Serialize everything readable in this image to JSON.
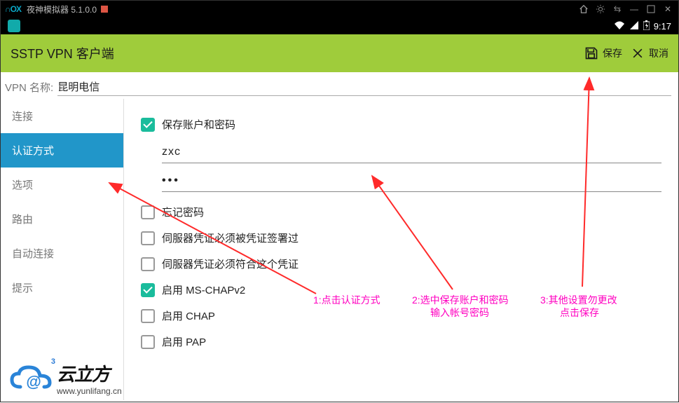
{
  "window": {
    "emulator_brand": "∩OX",
    "title": "夜神模拟器 5.1.0.0"
  },
  "status_bar": {
    "time": "9:17"
  },
  "app": {
    "title": "SSTP VPN 客户端",
    "save_label": "保存",
    "cancel_label": "取消"
  },
  "vpn_name": {
    "label": "VPN 名称:",
    "value": "昆明电信"
  },
  "sidebar": {
    "items": [
      {
        "label": "连接"
      },
      {
        "label": "认证方式"
      },
      {
        "label": "选项"
      },
      {
        "label": "路由"
      },
      {
        "label": "自动连接"
      },
      {
        "label": "提示"
      }
    ],
    "active_index": 1
  },
  "auth": {
    "save_credentials_label": "保存账户和密码",
    "username_value": "zxc",
    "password_value": "•••",
    "forget_password_label": "忘记密码",
    "server_cert_signed_label": "伺服器凭证必须被凭证签署过",
    "server_cert_match_label": "伺服器凭证必须符合这个凭证",
    "mschap_label": "启用 MS-CHAPv2",
    "chap_label": "启用 CHAP",
    "pap_label": "启用 PAP",
    "checked": {
      "save_credentials": true,
      "forget_password": false,
      "server_cert_signed": false,
      "server_cert_match": false,
      "mschap": true,
      "chap": false,
      "pap": false
    }
  },
  "annotations": {
    "a1": "1:点击认证方式",
    "a2_line1": "2:选中保存账户和密码",
    "a2_line2": "输入帐号密码",
    "a3_line1": "3:其他设置勿更改",
    "a3_line2": "点击保存"
  },
  "watermark": {
    "title": "云立方",
    "url": "www.yunlifang.cn",
    "at": "@"
  }
}
